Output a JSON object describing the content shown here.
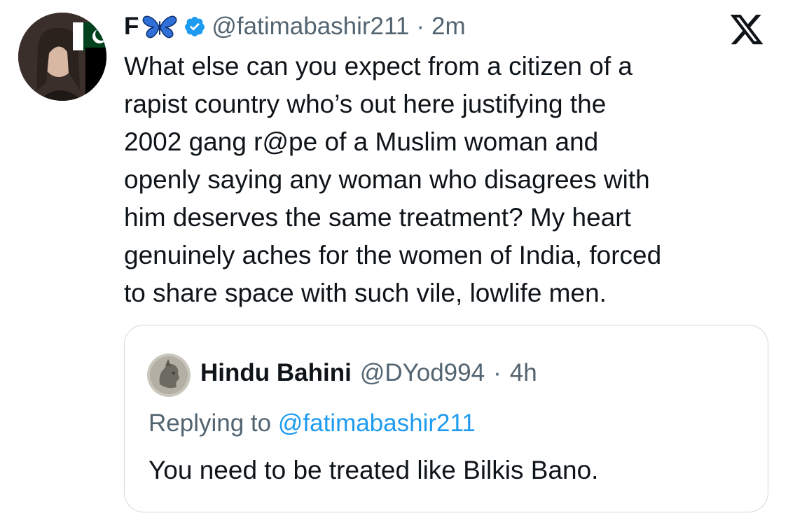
{
  "tweet": {
    "display_name": "F",
    "name_emoji": "butterfly-icon",
    "verified": "verified-badge-icon",
    "handle": "@fatimabashir211",
    "separator": "·",
    "time": "2m",
    "logo": "x-logo-icon",
    "body_lines": [
      "What else can you expect from a citizen of a",
      "rapist country who’s out here justifying the",
      "2002 gang r@pe of a Muslim woman and",
      "openly saying any woman who disagrees with",
      "him deserves the same treatment? My heart",
      "genuinely aches for the women of India, forced",
      "to share space with such vile, lowlife men."
    ]
  },
  "quoted": {
    "display_name": "Hindu Bahini",
    "handle": "@DYod994",
    "separator": "·",
    "time": "4h",
    "replying_prefix": "Replying to",
    "replying_mention": "@fatimabashir211",
    "text": "You need to be treated like Bilkis Bano."
  },
  "colors": {
    "text": "#0f1419",
    "secondary": "#536471",
    "link": "#1d9bf0",
    "border": "#cfd9de",
    "verified": "#1d9bf0"
  }
}
